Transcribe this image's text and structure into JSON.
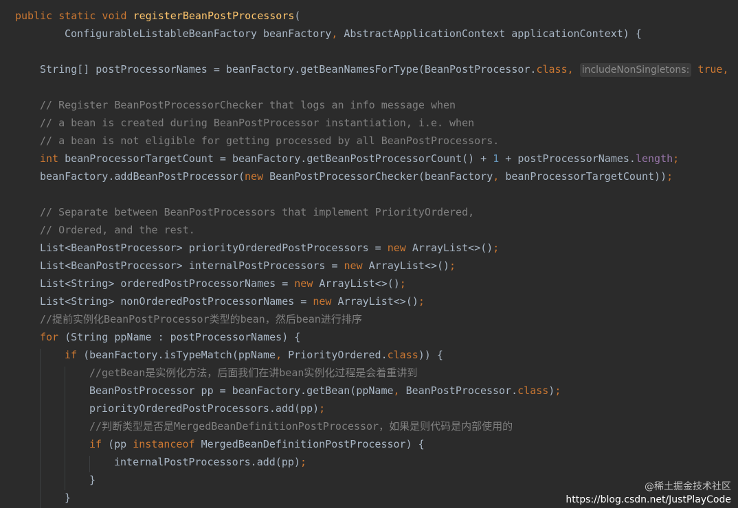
{
  "editor": {
    "lines": [
      {
        "segments": [
          {
            "t": "public static void ",
            "c": "kw"
          },
          {
            "t": "registerBeanPostProcessors",
            "c": "fn"
          },
          {
            "t": "(",
            "c": ""
          }
        ]
      },
      {
        "segments": [
          {
            "t": "ConfigurableListableBeanFactory beanFactory",
            "c": ""
          },
          {
            "t": ", ",
            "c": "kw"
          },
          {
            "t": "AbstractApplicationContext applicationContext) {",
            "c": ""
          }
        ]
      },
      {
        "segments": []
      },
      {
        "segments": [
          {
            "t": "String[] postProcessorNames = beanFactory.getBeanNamesForType(BeanPostProcessor.",
            "c": ""
          },
          {
            "t": "class",
            "c": "kw"
          },
          {
            "t": ", ",
            "c": "kw"
          },
          {
            "t": "includeNonSingletons:",
            "c": "hint"
          },
          {
            "t": " ",
            "c": ""
          },
          {
            "t": "true",
            "c": "kw"
          },
          {
            "t": ",",
            "c": "kw"
          }
        ]
      },
      {
        "segments": []
      },
      {
        "segments": [
          {
            "t": "// Register BeanPostProcessorChecker that logs an info message when",
            "c": "cm"
          }
        ]
      },
      {
        "segments": [
          {
            "t": "// a bean is created during BeanPostProcessor instantiation, i.e. when",
            "c": "cm"
          }
        ]
      },
      {
        "segments": [
          {
            "t": "// a bean is not eligible for getting processed by all BeanPostProcessors.",
            "c": "cm"
          }
        ]
      },
      {
        "segments": [
          {
            "t": "int ",
            "c": "kw"
          },
          {
            "t": "beanProcessorTargetCount = beanFactory.getBeanPostProcessorCount() + ",
            "c": ""
          },
          {
            "t": "1",
            "c": "num"
          },
          {
            "t": " + postProcessorNames.",
            "c": ""
          },
          {
            "t": "length",
            "c": "fld"
          },
          {
            "t": ";",
            "c": "kw"
          }
        ]
      },
      {
        "segments": [
          {
            "t": "beanFactory.addBeanPostProcessor(",
            "c": ""
          },
          {
            "t": "new ",
            "c": "kw"
          },
          {
            "t": "BeanPostProcessorChecker(beanFactory",
            "c": ""
          },
          {
            "t": ", ",
            "c": "kw"
          },
          {
            "t": "beanProcessorTargetCount))",
            "c": ""
          },
          {
            "t": ";",
            "c": "kw"
          }
        ]
      },
      {
        "segments": []
      },
      {
        "segments": [
          {
            "t": "// Separate between BeanPostProcessors that implement PriorityOrdered,",
            "c": "cm"
          }
        ]
      },
      {
        "segments": [
          {
            "t": "// Ordered, and the rest.",
            "c": "cm"
          }
        ]
      },
      {
        "segments": [
          {
            "t": "List<BeanPostProcessor> priorityOrderedPostProcessors = ",
            "c": ""
          },
          {
            "t": "new ",
            "c": "kw"
          },
          {
            "t": "ArrayList<>()",
            "c": ""
          },
          {
            "t": ";",
            "c": "kw"
          }
        ]
      },
      {
        "segments": [
          {
            "t": "List<BeanPostProcessor> internalPostProcessors = ",
            "c": ""
          },
          {
            "t": "new ",
            "c": "kw"
          },
          {
            "t": "ArrayList<>()",
            "c": ""
          },
          {
            "t": ";",
            "c": "kw"
          }
        ]
      },
      {
        "segments": [
          {
            "t": "List<String> orderedPostProcessorNames = ",
            "c": ""
          },
          {
            "t": "new ",
            "c": "kw"
          },
          {
            "t": "ArrayList<>()",
            "c": ""
          },
          {
            "t": ";",
            "c": "kw"
          }
        ]
      },
      {
        "segments": [
          {
            "t": "List<String> nonOrderedPostProcessorNames = ",
            "c": ""
          },
          {
            "t": "new ",
            "c": "kw"
          },
          {
            "t": "ArrayList<>()",
            "c": ""
          },
          {
            "t": ";",
            "c": "kw"
          }
        ]
      },
      {
        "segments": [
          {
            "t": "//提前实例化BeanPostProcessor类型的bean，然后bean进行排序",
            "c": "cm"
          }
        ]
      },
      {
        "segments": [
          {
            "t": "for ",
            "c": "kw"
          },
          {
            "t": "(String ppName : postProcessorNames) {",
            "c": ""
          }
        ]
      },
      {
        "segments": [
          {
            "t": "if ",
            "c": "kw"
          },
          {
            "t": "(beanFactory.isTypeMatch(ppName",
            "c": ""
          },
          {
            "t": ", ",
            "c": "kw"
          },
          {
            "t": "PriorityOrdered.",
            "c": ""
          },
          {
            "t": "class",
            "c": "kw"
          },
          {
            "t": ")) {",
            "c": ""
          }
        ]
      },
      {
        "segments": [
          {
            "t": "//getBean是实例化方法，后面我们在讲bean实例化过程是会着重讲到",
            "c": "cm"
          }
        ]
      },
      {
        "segments": [
          {
            "t": "BeanPostProcessor pp = beanFactory.getBean(ppName",
            "c": ""
          },
          {
            "t": ", ",
            "c": "kw"
          },
          {
            "t": "BeanPostProcessor.",
            "c": ""
          },
          {
            "t": "class",
            "c": "kw"
          },
          {
            "t": ")",
            "c": ""
          },
          {
            "t": ";",
            "c": "kw"
          }
        ]
      },
      {
        "segments": [
          {
            "t": "priorityOrderedPostProcessors.add(pp)",
            "c": ""
          },
          {
            "t": ";",
            "c": "kw"
          }
        ]
      },
      {
        "segments": [
          {
            "t": "//判断类型是否是MergedBeanDefinitionPostProcessor，如果是则代码是内部使用的",
            "c": "cm"
          }
        ]
      },
      {
        "segments": [
          {
            "t": "if ",
            "c": "kw"
          },
          {
            "t": "(pp ",
            "c": ""
          },
          {
            "t": "instanceof ",
            "c": "kw"
          },
          {
            "t": "MergedBeanDefinitionPostProcessor) {",
            "c": ""
          }
        ]
      },
      {
        "segments": [
          {
            "t": "internalPostProcessors.add(pp)",
            "c": ""
          },
          {
            "t": ";",
            "c": "kw"
          }
        ]
      },
      {
        "segments": [
          {
            "t": "}",
            "c": ""
          }
        ]
      },
      {
        "segments": [
          {
            "t": "}",
            "c": ""
          }
        ]
      }
    ]
  },
  "watermark": {
    "line1": "@稀土掘金技术社区",
    "line2": "https://blog.csdn.net/JustPlayCode"
  }
}
